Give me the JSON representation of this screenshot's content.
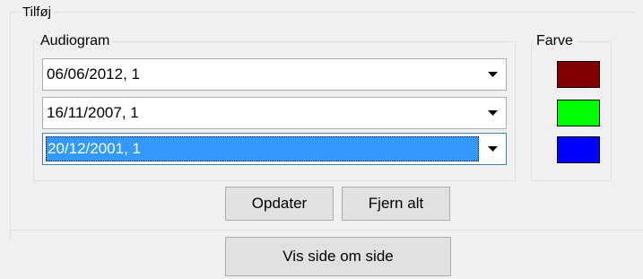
{
  "groups": {
    "tilfoj_label": "Tilføj",
    "audiogram_label": "Audiogram",
    "farve_label": "Farve"
  },
  "audiograms": [
    {
      "value": "06/06/2012, 1",
      "selected": false
    },
    {
      "value": "16/11/2007, 1",
      "selected": false
    },
    {
      "value": "20/12/2001, 1",
      "selected": true
    }
  ],
  "colors": [
    {
      "name": "dark-red",
      "hex": "#800000"
    },
    {
      "name": "green",
      "hex": "#00ff00"
    },
    {
      "name": "blue",
      "hex": "#0000ff"
    }
  ],
  "buttons": {
    "opdater": "Opdater",
    "fjern_alt": "Fjern alt",
    "vis_side_om_side": "Vis side om side"
  },
  "icons": {
    "dropdown": "chevron-down-icon"
  }
}
